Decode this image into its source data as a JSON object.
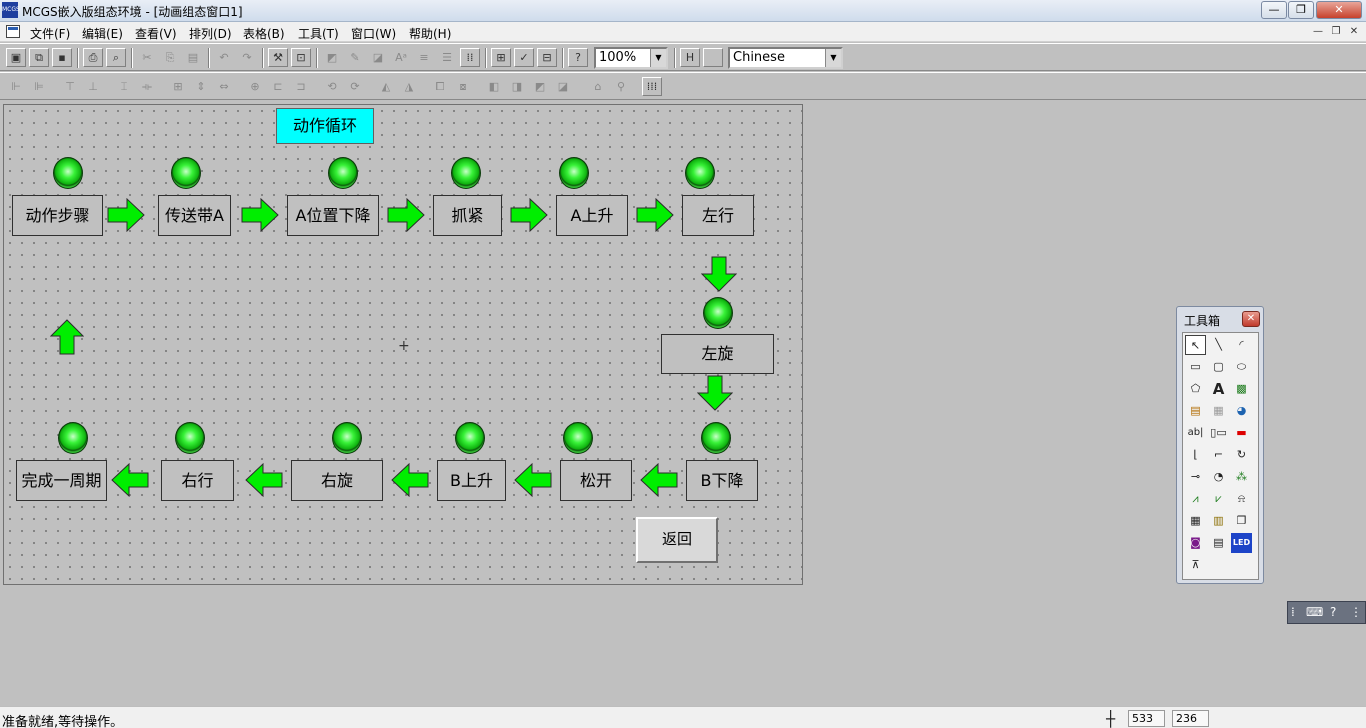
{
  "window": {
    "title": "MCGS嵌入版组态环境 - [动画组态窗口1]",
    "logo_text": "MCGS",
    "minimize": "—",
    "maximize": "❐",
    "close": "✕"
  },
  "menu": {
    "items": [
      "文件(F)",
      "编辑(E)",
      "查看(V)",
      "排列(D)",
      "表格(B)",
      "工具(T)",
      "窗口(W)",
      "帮助(H)"
    ],
    "mdi_minimize": "—",
    "mdi_restore": "❐",
    "mdi_close": "✕"
  },
  "toolbar": {
    "zoom": "100%",
    "language": "Chinese",
    "dropdown_arrow": "▼"
  },
  "canvas": {
    "title": "动作循环",
    "row1_steps": [
      "动作步骤",
      "传送带A",
      "A位置下降",
      "抓紧",
      "A上升",
      "左行"
    ],
    "right_step": "左旋",
    "row2_steps": [
      "完成一周期",
      "右行",
      "右旋",
      "B上升",
      "松开",
      "B下降"
    ],
    "back_button": "返回",
    "cursor_glyph": "+"
  },
  "toolbox": {
    "title": "工具箱",
    "close": "✕"
  },
  "status": {
    "text": "准备就绪,等待操作。",
    "x": "533",
    "y": "236",
    "crosshair": "┼"
  },
  "colors": {
    "lamp_on": "#33ee33",
    "arrow": "#00ee00",
    "title_box": "#00ffff",
    "canvas": "#c0c0c0"
  }
}
